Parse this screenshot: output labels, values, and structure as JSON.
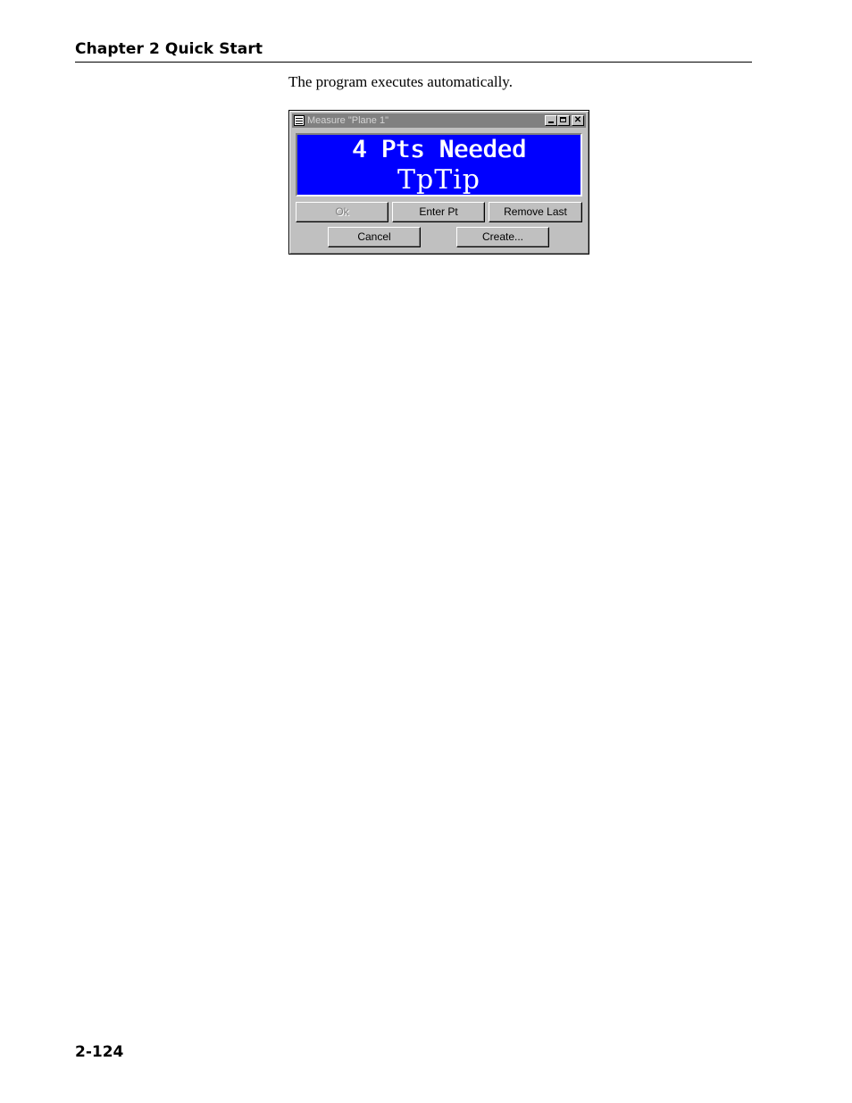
{
  "header": {
    "chapter_title": "Chapter 2 Quick Start"
  },
  "body": {
    "intro": "The program executes automatically."
  },
  "dialog": {
    "title": "Measure \"Plane 1\"",
    "display": {
      "line1": "4 Pts Needed",
      "line2": "TpTip",
      "background_color": "#0000ff",
      "text_color": "#ffffff"
    },
    "buttons": {
      "ok": "Ok",
      "enter_pt": "Enter Pt",
      "remove_last": "Remove Last",
      "cancel": "Cancel",
      "create": "Create..."
    },
    "icons": {
      "window": "window-icon",
      "minimize": "minimize-icon",
      "maximize": "maximize-icon",
      "close": "close-icon"
    }
  },
  "footer": {
    "page_number": "2-124"
  }
}
